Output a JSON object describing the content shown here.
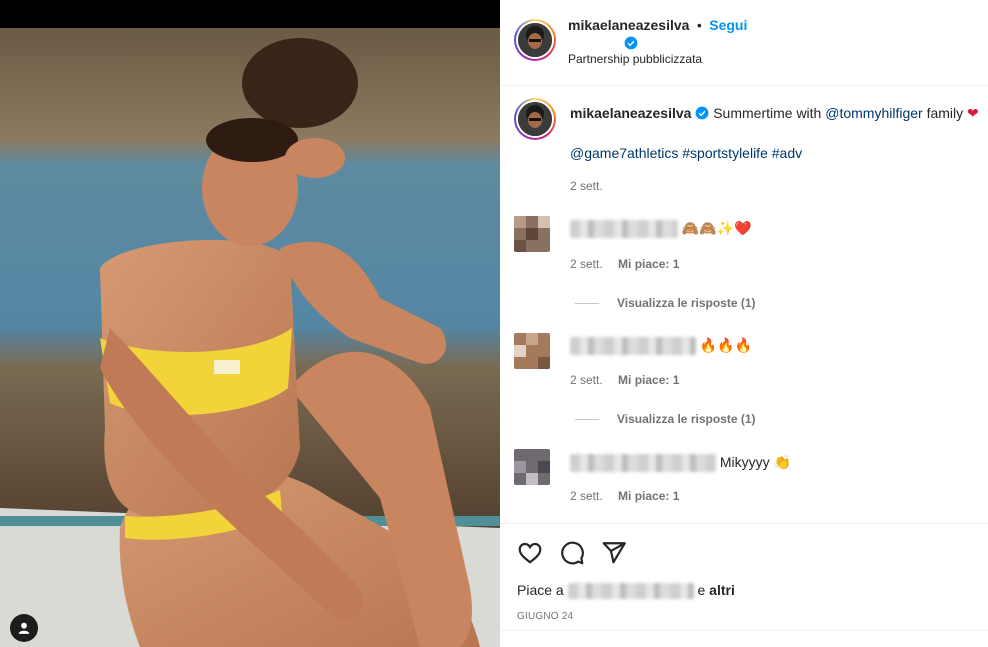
{
  "post": {
    "username": "mikaelaneazesilva",
    "separator": "•",
    "follow_label": "Segui",
    "partnership_label": "Partnership pubblicizzata"
  },
  "caption": {
    "username": "mikaelaneazesilva",
    "text_before": "Summertime with ",
    "mention": "@tommyhilfiger",
    "text_after": " family",
    "tags": "@game7athletics #sportstylelife #adv",
    "time": "2 sett."
  },
  "comments": [
    {
      "emoji": "🙈🙈✨❤️",
      "text": "",
      "time": "2 sett.",
      "likes": "Mi piace: 1",
      "replies": "Visualizza le risposte (1)"
    },
    {
      "emoji": "🔥🔥🔥",
      "text": "",
      "time": "2 sett.",
      "likes": "Mi piace: 1",
      "replies": "Visualizza le risposte (1)"
    },
    {
      "emoji": "👏",
      "text": "Mikyyyy",
      "time": "2 sett.",
      "likes": "Mi piace: 1"
    }
  ],
  "likes_line": {
    "prefix": "Piace a",
    "suffix": "e",
    "others": "altri"
  },
  "post_date": "GIUGNO 24",
  "icons": [
    "heart-icon",
    "comment-icon",
    "share-icon",
    "verified-badge-icon",
    "person-tag-icon"
  ],
  "colors": {
    "follow": "#0095f6",
    "verified": "#0095f6",
    "link": "#00376b",
    "muted": "#737373"
  }
}
